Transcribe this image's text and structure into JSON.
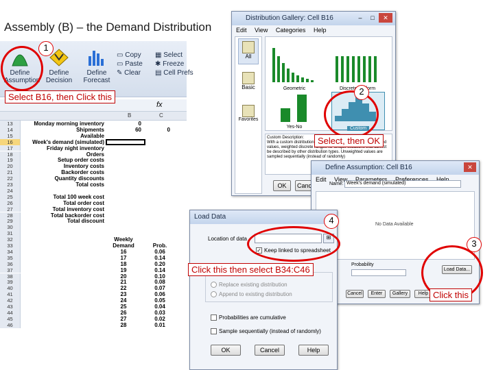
{
  "slide": {
    "title": "Assembly (B) – the Demand Distribution"
  },
  "ribbon": {
    "buttons": [
      "Define Assumption",
      "Define Decision",
      "Define Forecast"
    ],
    "copy": "Copy",
    "paste": "Paste",
    "clear": "Clear",
    "select": "Select",
    "freeze": "Freeze",
    "cell_prefs": "Cell Prefs"
  },
  "formula_bar": {
    "fx": "fx"
  },
  "columns": [
    "B",
    "C"
  ],
  "rows": [
    {
      "n": "13",
      "label": "Monday morning inventory",
      "b": "0",
      "c": ""
    },
    {
      "n": "14",
      "label": "Shipments",
      "b": "60",
      "c": "0"
    },
    {
      "n": "15",
      "label": "Available",
      "b": "",
      "c": ""
    },
    {
      "n": "16",
      "label": "Week's demand (simulated)",
      "b": "",
      "c": ""
    },
    {
      "n": "17",
      "label": "Friday night inventory",
      "b": "",
      "c": ""
    },
    {
      "n": "18",
      "label": "Orders",
      "b": "",
      "c": ""
    },
    {
      "n": "19",
      "label": "Setup order costs",
      "b": "",
      "c": ""
    },
    {
      "n": "20",
      "label": "Inventory costs",
      "b": "",
      "c": ""
    },
    {
      "n": "21",
      "label": "Backorder costs",
      "b": "",
      "c": ""
    },
    {
      "n": "22",
      "label": "Quantity discounts",
      "b": "",
      "c": ""
    },
    {
      "n": "23",
      "label": "Total costs",
      "b": "",
      "c": ""
    },
    {
      "n": "24",
      "label": "",
      "b": "",
      "c": ""
    },
    {
      "n": "25",
      "label": "Total 100 week cost",
      "b": "",
      "c": ""
    },
    {
      "n": "26",
      "label": "Total order cost",
      "b": "",
      "c": ""
    },
    {
      "n": "27",
      "label": "Total inventory cost",
      "b": "",
      "c": ""
    },
    {
      "n": "28",
      "label": "Total backorder cost",
      "b": "",
      "c": ""
    },
    {
      "n": "29",
      "label": "Total discount",
      "b": "",
      "c": ""
    },
    {
      "n": "30",
      "label": "",
      "b": "",
      "c": ""
    },
    {
      "n": "31",
      "label": "",
      "b": "",
      "c": ""
    },
    {
      "n": "32",
      "label": "",
      "b": "Weekly",
      "c": ""
    },
    {
      "n": "33",
      "label": "",
      "b": "Demand",
      "c": "Prob."
    },
    {
      "n": "34",
      "label": "",
      "b": "16",
      "c": "0.06"
    },
    {
      "n": "35",
      "label": "",
      "b": "17",
      "c": "0.14"
    },
    {
      "n": "36",
      "label": "",
      "b": "18",
      "c": "0.20"
    },
    {
      "n": "37",
      "label": "",
      "b": "19",
      "c": "0.14"
    },
    {
      "n": "38",
      "label": "",
      "b": "20",
      "c": "0.10"
    },
    {
      "n": "39",
      "label": "",
      "b": "21",
      "c": "0.08"
    },
    {
      "n": "40",
      "label": "",
      "b": "22",
      "c": "0.07"
    },
    {
      "n": "41",
      "label": "",
      "b": "23",
      "c": "0.06"
    },
    {
      "n": "42",
      "label": "",
      "b": "24",
      "c": "0.05"
    },
    {
      "n": "43",
      "label": "",
      "b": "25",
      "c": "0.04"
    },
    {
      "n": "44",
      "label": "",
      "b": "26",
      "c": "0.03"
    },
    {
      "n": "45",
      "label": "",
      "b": "27",
      "c": "0.02"
    },
    {
      "n": "46",
      "label": "",
      "b": "28",
      "c": "0.01"
    }
  ],
  "gallery": {
    "title": "Distribution Gallery: Cell B16",
    "menu": [
      "Edit",
      "View",
      "Categories",
      "Help"
    ],
    "categories": [
      "All",
      "Basic",
      "Favorites"
    ],
    "distributions": [
      "Geometric",
      "Discrete Uniform",
      "Yes-No",
      "Custom"
    ],
    "desc_title": "Custom Description:",
    "desc_text": "With a custom distribution, you can use weighted and unweighted values, weighted discrete ranges for unique situations that cannot be described by other distribution types. Unweighted values are sampled sequentially (instead of randomly)",
    "ok": "OK",
    "cancel": "Cancel"
  },
  "define_assumption": {
    "title": "Define Assumption: Cell B16",
    "menu": [
      "Edit",
      "View",
      "Parameters",
      "Preferences",
      "Help"
    ],
    "name_label": "Name:",
    "name_value": "Week's demand (simulated)",
    "no_data": "No Data Available",
    "probability_label": "Probability",
    "load_data": "Load Data...",
    "buttons": [
      "Cancel",
      "Enter",
      "Gallery",
      "Help"
    ]
  },
  "load_data": {
    "title": "Load Data",
    "location_label": "Location of data",
    "keep_linked": "Keep linked to spreadsheet",
    "replace": "Replace existing distribution",
    "append": "Append to existing distribution",
    "cumulative": "Probabilities are cumulative",
    "sequential": "Sample sequentially (instead of randomly)",
    "ok": "OK",
    "cancel": "Cancel",
    "help": "Help"
  },
  "callouts": {
    "c1": "Select B16, then Click this",
    "c2": "Select, then OK",
    "c3": "Click this",
    "c4": "Click this then select  B34:C46"
  },
  "step_numbers": [
    "1",
    "2",
    "3",
    "4"
  ],
  "colors": {
    "callout_red": "#c00000",
    "ring_red": "#e00000",
    "bar_green": "#1a8a2a",
    "custom_teal": "#3f8fb0"
  }
}
